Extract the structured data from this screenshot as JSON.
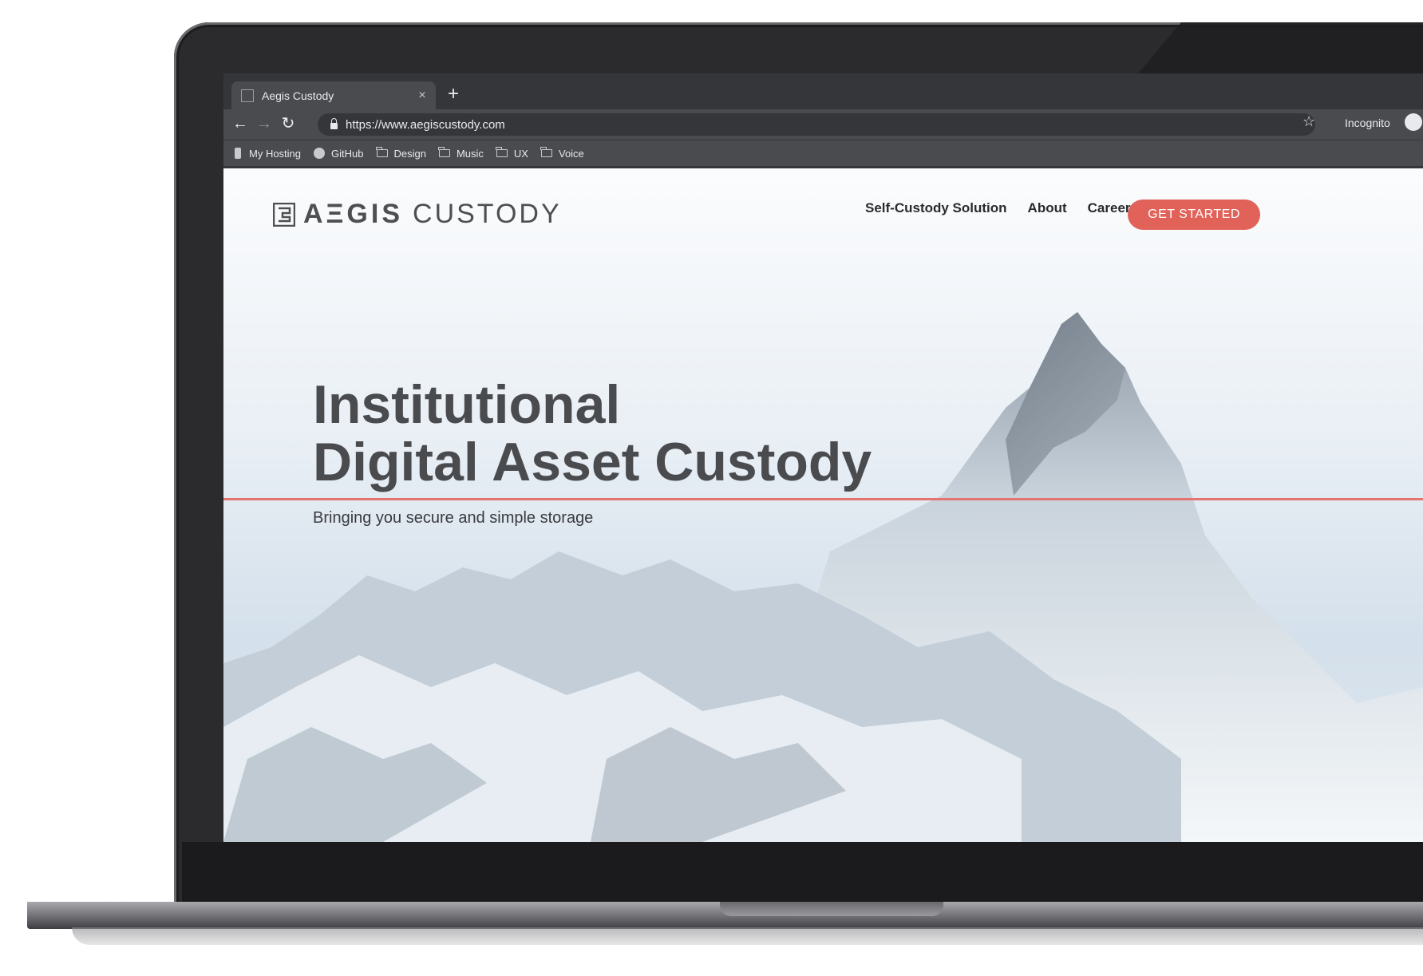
{
  "browser": {
    "tab_title": "Aegis Custody",
    "tab_close": "×",
    "new_tab": "+",
    "url": "https://www.aegiscustody.com",
    "incognito_label": "Incognito",
    "nav_back": "←",
    "nav_forward": "→",
    "nav_reload": "↻",
    "star": "☆",
    "bookmarks": [
      "My Hosting",
      "GitHub",
      "Design",
      "Music",
      "UX",
      "Voice"
    ]
  },
  "site": {
    "logo_bold": "AΞGIS",
    "logo_light": "CUSTODY",
    "nav": [
      "Self-Custody Solution",
      "About",
      "Careers"
    ],
    "cta": "GET STARTED",
    "headline_line1": "Institutional",
    "headline_line2": "Digital Asset Custody",
    "subheadline": "Bringing you secure and simple storage",
    "accent_color": "#e16259"
  }
}
